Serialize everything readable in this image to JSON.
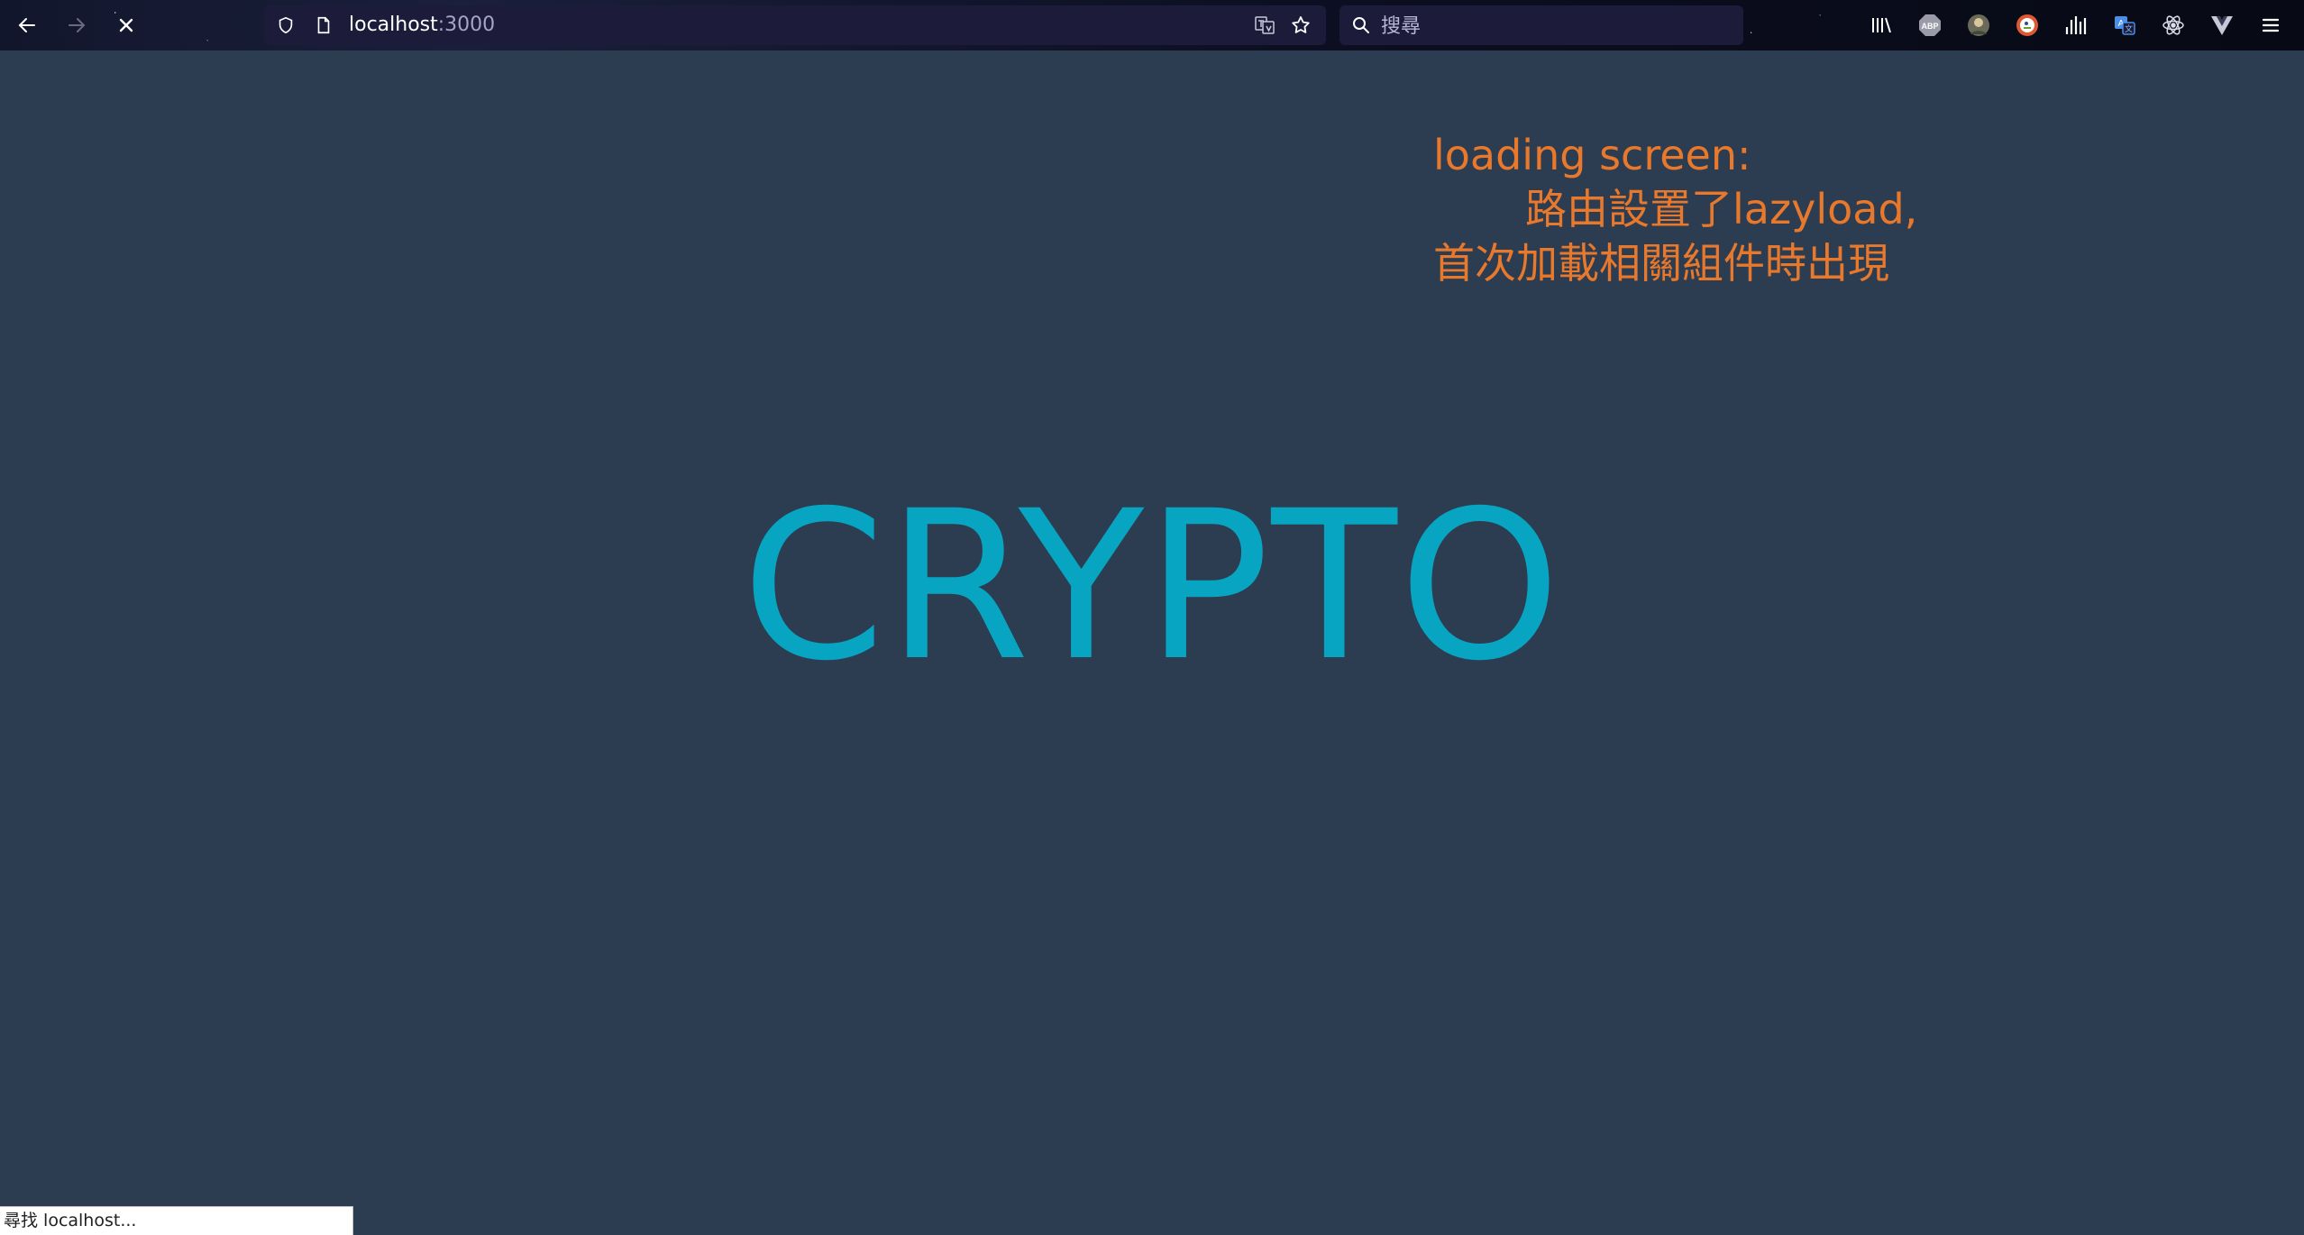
{
  "browser": {
    "url_host": "localhost",
    "url_port": ":3000",
    "search_placeholder": "搜尋"
  },
  "page": {
    "annotation_line1": "loading screen:",
    "annotation_line2": "路由設置了lazyload,",
    "annotation_line3": "首次加載相關組件時出現",
    "logo": "CRYPTO"
  },
  "status_bar": {
    "text": "尋找 localhost..."
  },
  "colors": {
    "background": "#2c3d51",
    "logo": "#08a5c2",
    "annotation": "#e8782b"
  },
  "icons": {
    "toolbar": [
      "back-icon",
      "forward-icon",
      "stop-icon",
      "shield-icon",
      "page-icon",
      "translate-icon",
      "bookmark-star-icon",
      "search-icon"
    ],
    "extensions": [
      "library-icon",
      "adblock-icon",
      "avatar-icon",
      "duckduckgo-icon",
      "equalizer-icon",
      "translate-ext-icon",
      "react-devtools-icon",
      "vue-devtools-icon",
      "menu-icon"
    ]
  }
}
